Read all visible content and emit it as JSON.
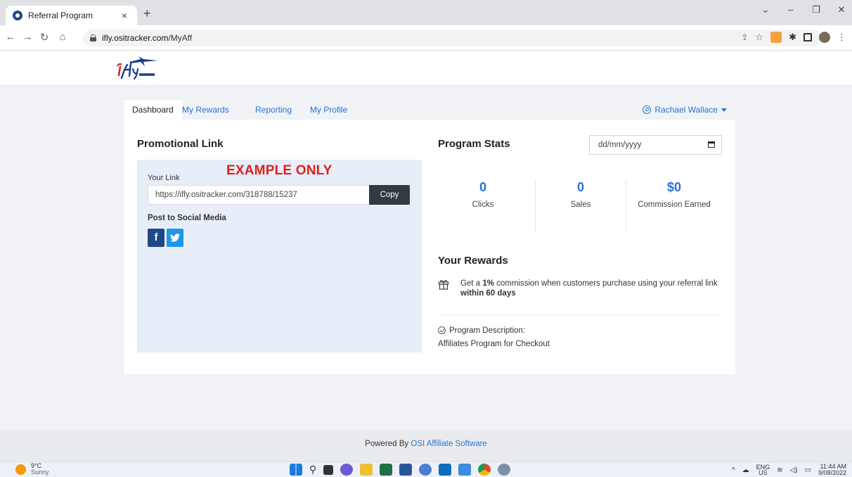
{
  "browser": {
    "tab_title": "Referral Program",
    "tab_close": "×",
    "new_tab": "+",
    "url_host": "ifly.ositracker.com",
    "url_path": "/MyAff"
  },
  "nav": {
    "tabs": [
      {
        "label": "Dashboard",
        "active": true
      },
      {
        "label": "My Rewards"
      },
      {
        "label": "Reporting"
      },
      {
        "label": "My Profile"
      }
    ],
    "user_name": "Rachael Wallace"
  },
  "promo": {
    "title": "Promotional Link",
    "watermark": "EXAMPLE ONLY",
    "your_link_label": "Your Link",
    "link_value": "https://ifly.ositracker.com/318788/15237",
    "copy_label": "Copy",
    "social_label": "Post to Social Media"
  },
  "stats": {
    "title": "Program Stats",
    "date_placeholder": "dd/mm/yyyy",
    "items": [
      {
        "value": "0",
        "label": "Clicks"
      },
      {
        "value": "0",
        "label": "Sales"
      },
      {
        "value": "$0",
        "label": "Commission Earned"
      }
    ]
  },
  "rewards": {
    "title": "Your Rewards",
    "text_prefix": "Get a ",
    "text_bold1": "1%",
    "text_mid": " commission when customers purchase using your referral link ",
    "text_bold2": "within 60 days",
    "description_label": "Program Description:",
    "description_value": "Affiliates Program for Checkout"
  },
  "footer": {
    "prefix": "Powered By ",
    "link": "OSI Affiliate Software"
  },
  "taskbar": {
    "temp": "9°C",
    "condition": "Sunny",
    "lang_top": "ENG",
    "lang_bottom": "US",
    "time": "11:44 AM",
    "date": "9/08/2022"
  },
  "colors": {
    "accent": "#2b72d3",
    "watermark": "#e02020",
    "facebook": "#1d4a86",
    "twitter": "#1e97e6",
    "copy_button": "#333a40"
  }
}
